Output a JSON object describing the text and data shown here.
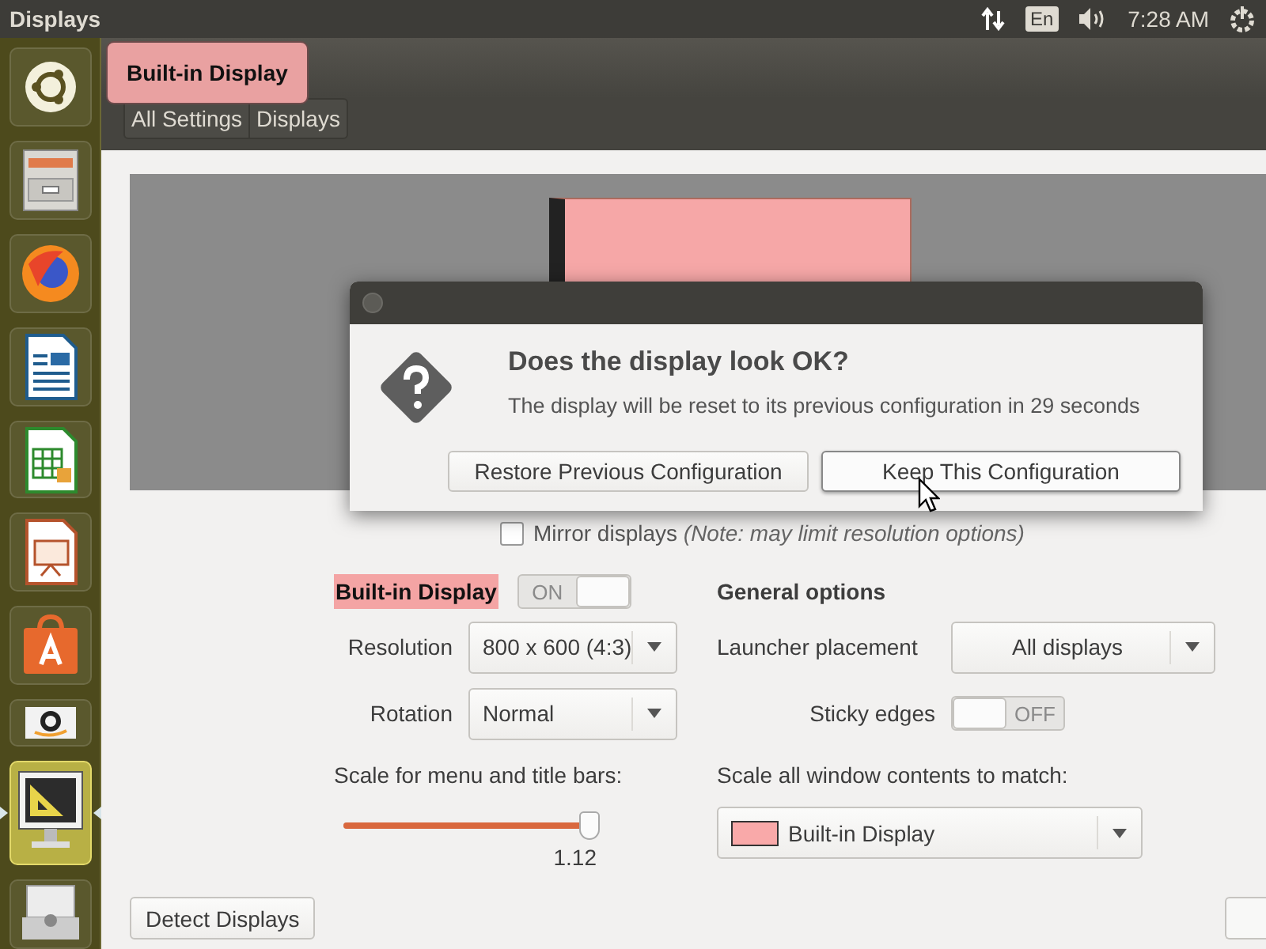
{
  "top_panel": {
    "title": "Displays",
    "keyboard": "En",
    "clock": "7:28 AM"
  },
  "launcher": [
    {
      "kind": "ubuntu",
      "selected": false
    },
    {
      "kind": "files",
      "selected": false
    },
    {
      "kind": "browser",
      "selected": false
    },
    {
      "kind": "writer",
      "selected": false
    },
    {
      "kind": "calc",
      "selected": false
    },
    {
      "kind": "impress",
      "selected": false
    },
    {
      "kind": "store",
      "selected": false
    },
    {
      "kind": "amazon",
      "selected": false
    },
    {
      "kind": "displays",
      "selected": true
    },
    {
      "kind": "dvd",
      "selected": false
    }
  ],
  "tooltip": "Built-in Display",
  "breadcrumbs": [
    "All Settings",
    "Displays"
  ],
  "mirror": {
    "label": "Mirror displays",
    "note": "(Note: may limit resolution options)",
    "checked": false
  },
  "display": {
    "name": "Built-in Display",
    "switch": {
      "label": "ON",
      "on": true
    },
    "resolution": {
      "label": "Resolution",
      "value": "800 x 600 (4:3)"
    },
    "rotation": {
      "label": "Rotation",
      "value": "Normal"
    },
    "scale": {
      "label": "Scale for menu and title bars:",
      "level": 0.97,
      "reading": "1.12"
    }
  },
  "general": {
    "title": "General options",
    "launcher_placement": {
      "label": "Launcher placement",
      "value": "All displays"
    },
    "sticky_edges": {
      "label": "Sticky edges",
      "switch": {
        "label": "OFF",
        "on": false
      }
    },
    "scale_all": {
      "label": "Scale all window contents to match:",
      "value": "Built-in Display",
      "color": "#f9a9a9"
    }
  },
  "buttons": [
    "Detect Displays"
  ],
  "dialog": {
    "question": "Does the display look OK?",
    "message": "The display will be reset to its previous configuration in 29 seconds",
    "buttons": [
      {
        "label": "Restore Previous Configuration",
        "focused": false
      },
      {
        "label": "Keep This Configuration",
        "focused": true
      }
    ]
  }
}
